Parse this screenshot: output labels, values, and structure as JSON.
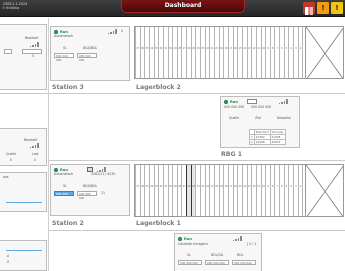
{
  "header": {
    "left_line1": "CBSC1.1.2024",
    "left_line2": "f: Kristina",
    "title": "Dashboard",
    "warn_glyph": "!",
    "alarm_glyph": "!"
  },
  "left_strip": {
    "top": {
      "label": "Bearbeit",
      "value": "0"
    },
    "mid": {
      "label": "Bearbeit",
      "left": "Quelle",
      "right": "Last",
      "val_a": "0",
      "val_b": "0"
    },
    "bottom": {
      "label": "oos"
    },
    "bottom2": {
      "a": "-0",
      "b": "-0"
    }
  },
  "station3": {
    "title": "Station 3",
    "status": "Run",
    "mode": "Automatsch",
    "col1": "VL",
    "col2": "BGA/BGL",
    "field1": "000 000 000",
    "field2": "000 000 000",
    "count": "0"
  },
  "station2": {
    "title": "Station 2",
    "status": "Run",
    "mode": "Automatsch",
    "code": "3282/11 | 6130",
    "col1": "VL",
    "col2": "BGA/BGL",
    "field1": "000 000 000",
    "field2": "000 000 000",
    "count": "21"
  },
  "lagerblock2": {
    "title": "Lagerblock 2",
    "cells": [
      "37",
      "36",
      "35",
      "34",
      "33",
      "32",
      "31",
      "30",
      "29",
      "28",
      "27",
      "26",
      "25",
      "24",
      "23",
      "22",
      "21",
      "20",
      "19",
      "18",
      "17",
      "16",
      "15",
      "14",
      "13",
      "12",
      "11",
      "10",
      "9",
      "8",
      "7",
      "6",
      "5",
      "4",
      "3",
      "2",
      "1"
    ]
  },
  "lagerblock1": {
    "title": "Lagerblock 1",
    "cells": [
      "37",
      "36",
      "35",
      "34",
      "33",
      "32",
      "31",
      "30",
      "29",
      "28",
      "27",
      "26",
      "25",
      "24",
      "23",
      "22",
      "21",
      "20",
      "19",
      "18",
      "17",
      "16",
      "15",
      "14",
      "13",
      "12",
      "11",
      "10",
      "9",
      "8",
      "7",
      "6",
      "5",
      "4",
      "3",
      "2",
      "1"
    ]
  },
  "rbg1": {
    "title": "RBG 1",
    "status": "Run",
    "field1": "000 000 000",
    "field2": "000 000 000",
    "h_quelle": "Quelle",
    "h_ziel": "Ziel",
    "h_kassette": "Kassette",
    "row_head": [
      "",
      "Standard",
      "Turnover"
    ],
    "rows": [
      [
        "1",
        "21362",
        "21008"
      ],
      [
        "2",
        "21098",
        "22872"
      ]
    ]
  },
  "cassette": {
    "status": "Run",
    "mode": "Cassette einlagern",
    "count": "[ 0 / 1",
    "col1": "VL",
    "col2": "BGL/GA",
    "col3": "BGL",
    "f1": "000 000 000",
    "f2": "000 000 000",
    "f3": "000 000 000"
  },
  "colors": {
    "topbar": "#2d2d2d",
    "title_red": "#6b0e0e",
    "run_green": "#27ae60",
    "highlight_blue": "#5dade2",
    "doors": "#c0392b",
    "warn": "#f39c12",
    "alarm": "#f1c40f"
  },
  "icons": [
    "doors-icon",
    "warning-icon",
    "alarm-icon",
    "signal-icon",
    "robot-icon",
    "cross-box-icon"
  ]
}
